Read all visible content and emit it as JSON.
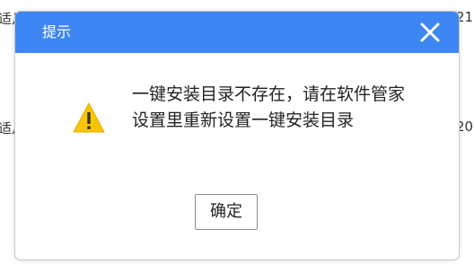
{
  "background": {
    "left_top": "适月",
    "left_mid": "适月",
    "right_top": "21",
    "right_mid": "20"
  },
  "dialog": {
    "title": "提示",
    "message": "一键安装目录不存在，请在软件管家设置里重新设置一键安装目录",
    "ok_label": "确定",
    "title_bar_color": "#3d86f4",
    "warning_color": "#f7c600"
  },
  "icons": {
    "close": "close-icon",
    "warning": "warning-icon"
  }
}
